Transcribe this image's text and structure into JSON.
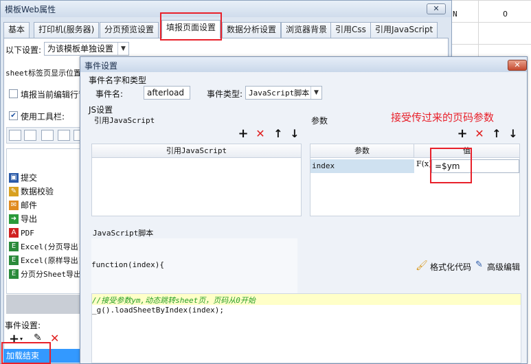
{
  "background_sheet": {
    "col_header_n": "N",
    "cell_value": "0"
  },
  "outer_dialog": {
    "title": "模板Web属性",
    "close_symbol": "✕",
    "tabs": [
      "基本",
      "打印机(服务器)",
      "分页预览设置",
      "填报页面设置",
      "数据分析设置",
      "浏览器背景",
      "引用Css",
      "引用JavaScript"
    ],
    "active_tab": "填报页面设置",
    "settings_label": "以下设置:",
    "settings_select_value": "为该模板单独设置",
    "sheet_tab_position_label": "sheet标签页显示位置",
    "checkbox_current_row": "填报当前编辑行背",
    "checkbox_use_toolbar": "使用工具栏:",
    "button_list": [
      "提交",
      "数据校验",
      "邮件",
      "导出",
      "PDF",
      "Excel(分页导出)",
      "Excel(原样导出)",
      "分页分Sheet导出"
    ],
    "event_settings_label": "事件设置:",
    "event_item": "加载结束"
  },
  "inner_dialog": {
    "title": "事件设置",
    "close_symbol": "✕",
    "event_name_type_section": "事件名字和类型",
    "event_name_label": "事件名:",
    "event_name_value": "afterload",
    "event_type_label": "事件类型:",
    "event_type_value": "JavaScript脚本",
    "js_section": "JS设置",
    "ref_js_label": "引用JavaScript",
    "ref_js_column": "引用JavaScript",
    "params_label": "参数",
    "params_columns": [
      "参数",
      "值"
    ],
    "params_rows": [
      {
        "name": "index",
        "formula_icon": "F(x)",
        "value": "=$ym"
      }
    ],
    "annotation": "接受传过来的页码参数",
    "js_script_label": "JavaScript脚本",
    "function_signature": "function(index){",
    "format_code": "格式化代码",
    "advanced_edit": "高级编辑",
    "code_comment": "//接受参数ym,动态跳转sheet页，页码从0开始",
    "code_line": "_g().loadSheetByIndex(index);"
  },
  "colors": {
    "highlight_red": "#e8202a",
    "selection_blue": "#3399ff",
    "comment_bg": "#ffffc8",
    "comment_text": "#2aa02a"
  }
}
